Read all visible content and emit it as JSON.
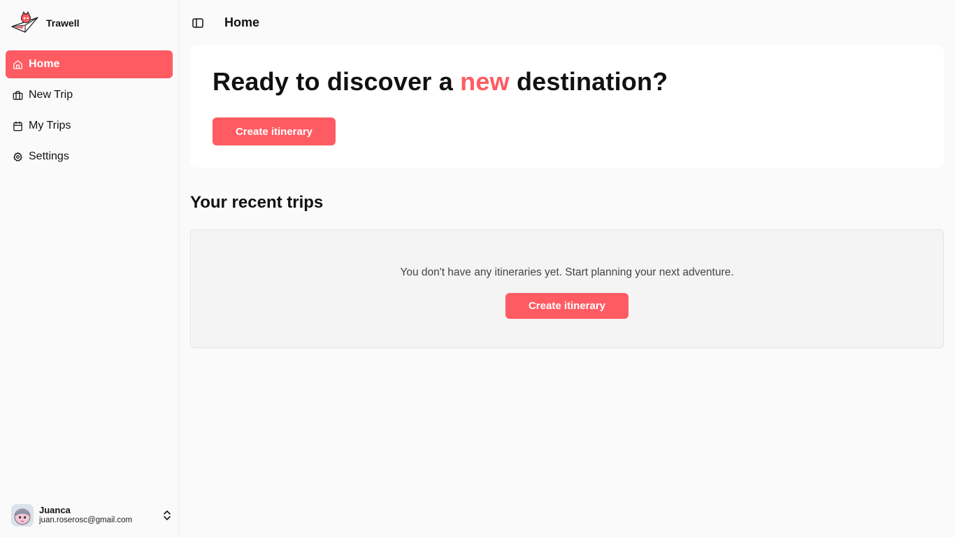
{
  "brand": {
    "name": "Trawell",
    "logo_icon": "paper-plane-mascot-icon"
  },
  "sidebar": {
    "items": [
      {
        "label": "Home",
        "icon": "home-icon",
        "active": true
      },
      {
        "label": "New Trip",
        "icon": "briefcase-icon",
        "active": false
      },
      {
        "label": "My Trips",
        "icon": "calendar-icon",
        "active": false
      },
      {
        "label": "Settings",
        "icon": "gear-icon",
        "active": false
      }
    ]
  },
  "user": {
    "name": "Juanca",
    "email": "juan.roserosc@gmail.com",
    "menu_icon": "chevrons-up-down-icon"
  },
  "header": {
    "title": "Home",
    "toggle_icon": "sidebar-toggle-icon"
  },
  "hero": {
    "title_before": "Ready to discover a ",
    "title_accent": "new",
    "title_after": " destination?",
    "button_label": "Create itinerary"
  },
  "recent": {
    "title": "Your recent trips",
    "empty_message": "You don't have any itineraries yet. Start planning your next adventure.",
    "button_label": "Create itinerary"
  },
  "colors": {
    "accent": "#ff5b63",
    "background": "#fafafa",
    "card": "#ffffff",
    "empty_panel": "#f4f4f4"
  }
}
